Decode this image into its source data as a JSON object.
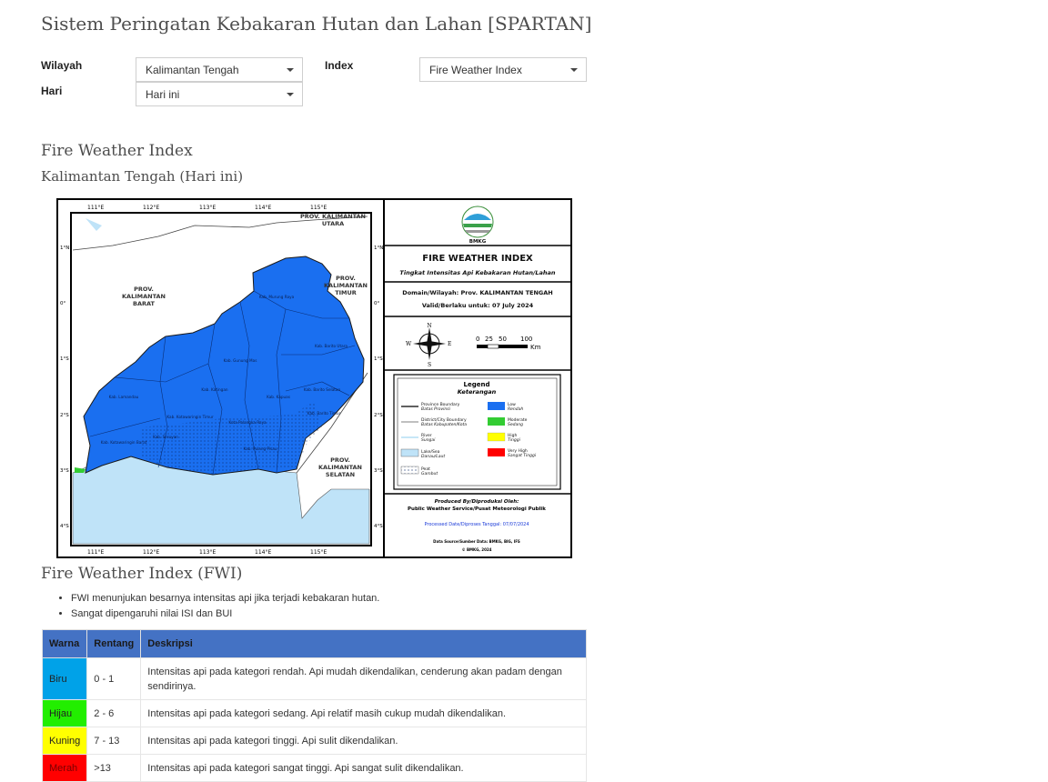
{
  "page": {
    "title": "Sistem Peringatan Kebakaran Hutan dan Lahan [SPARTAN]"
  },
  "filters": {
    "wilayah_label": "Wilayah",
    "wilayah_value": "Kalimantan Tengah",
    "index_label": "Index",
    "index_value": "Fire Weather Index",
    "hari_label": "Hari",
    "hari_value": "Hari ini"
  },
  "section": {
    "title": "Fire Weather Index",
    "subtitle": "Kalimantan Tengah (Hari ini)"
  },
  "map": {
    "lon_ticks": [
      "111°E",
      "112°E",
      "113°E",
      "114°E",
      "115°E"
    ],
    "lat_ticks": [
      "1°N",
      "0°",
      "1°S",
      "2°S",
      "3°S",
      "4°S"
    ],
    "region_labels": {
      "kaltara": "PROV. KALIMANTAN UTARA",
      "kalbar": "PROV. KALIMANTAN BARAT",
      "kaltim": "PROV. KALIMANTAN TIMUR",
      "kalsel": "PROV. KALIMANTAN SELATAN"
    },
    "regency_labels": [
      "Kab. Murung Raya",
      "Kab. Barito Utara",
      "Kab. Gunung Mas",
      "Kab. Lamandau",
      "Kab. Katingan",
      "Kab. Kotawaringin Timur",
      "Kab. Kapuas",
      "Kab. Barito Selatan",
      "Kab. Barito Timur",
      "Kab. Kotawaringin Barat",
      "Kab. Seruyan",
      "Kab. Pulang Pisau",
      "Kota Palangka Raya"
    ],
    "logo_text": "BMKG",
    "heading": "FIRE WEATHER INDEX",
    "heading_sub": "Tingkat Intensitas Api Kebakaran Hutan/Lahan",
    "domain_line": "Domain/Wilayah: Prov. KALIMANTAN TENGAH",
    "valid_line": "Valid/Berlaku untuk: 07 July 2024",
    "scale_labels": [
      "0",
      "25",
      "50",
      "100"
    ],
    "scale_unit": "Km",
    "compass": [
      "N",
      "E",
      "S",
      "W"
    ],
    "legend_title": "Legend",
    "legend_subtitle": "Keterangan",
    "legend_lines": [
      {
        "en": "Province Boundary",
        "id": "Batas Provinsi"
      },
      {
        "en": "District/City Boundary",
        "id": "Batas Kabupaten/Kota"
      },
      {
        "en": "River",
        "id": "Sungai"
      }
    ],
    "legend_fills": [
      {
        "en": "Lake/Sea",
        "id": "Danau/Laut",
        "color": "#bfe3f8"
      },
      {
        "en": "Peat",
        "id": "Gambut",
        "color": "#ffffff"
      }
    ],
    "legend_classes": [
      {
        "en": "Low",
        "id": "Rendah",
        "color": "#1a6ff0"
      },
      {
        "en": "Moderate",
        "id": "Sedang",
        "color": "#33cc33"
      },
      {
        "en": "High",
        "id": "Tinggi",
        "color": "#ffff00"
      },
      {
        "en": "Very High",
        "id": "Sangat Tinggi",
        "color": "#ff0000"
      }
    ],
    "produced_by": "Produced By/Diproduksi Oleh:",
    "producer": "Public Weather Service/Pusat Meteorologi Publik",
    "processed": "Processed Date/Diproses Tanggal: 07/07/2024",
    "data_source": "Data Source/Sumber Data: BMKG, BIG, IFS",
    "copyright": "© BMKG, 2024",
    "colors": {
      "land": "#1a6ff0",
      "sea": "#bfe3f8",
      "outside": "#ffffff"
    }
  },
  "fwi": {
    "title": "Fire Weather Index (FWI)",
    "bullets": [
      "FWI menunjukan besarnya intensitas api jika terjadi kebakaran hutan.",
      "Sangat dipengaruhi nilai ISI dan BUI"
    ],
    "table": {
      "headers": [
        "Warna",
        "Rentang",
        "Deskripsi"
      ],
      "rows": [
        {
          "warna": "Biru",
          "color": "#00a2e8",
          "rentang": "0 - 1",
          "deskripsi": "Intensitas api pada kategori rendah. Api mudah dikendalikan, cenderung akan padam dengan sendirinya."
        },
        {
          "warna": "Hijau",
          "color": "#22ee00",
          "rentang": "2 - 6",
          "deskripsi": "Intensitas api pada kategori sedang. Api relatif masih cukup mudah dikendalikan."
        },
        {
          "warna": "Kuning",
          "color": "#ffff00",
          "rentang": "7 - 13",
          "deskripsi": "Intensitas api pada kategori tinggi. Api sulit dikendalikan."
        },
        {
          "warna": "Merah",
          "color": "#ff0000",
          "rentang": ">13",
          "deskripsi": "Intensitas api pada kategori sangat tinggi. Api sangat sulit dikendalikan."
        }
      ]
    }
  }
}
